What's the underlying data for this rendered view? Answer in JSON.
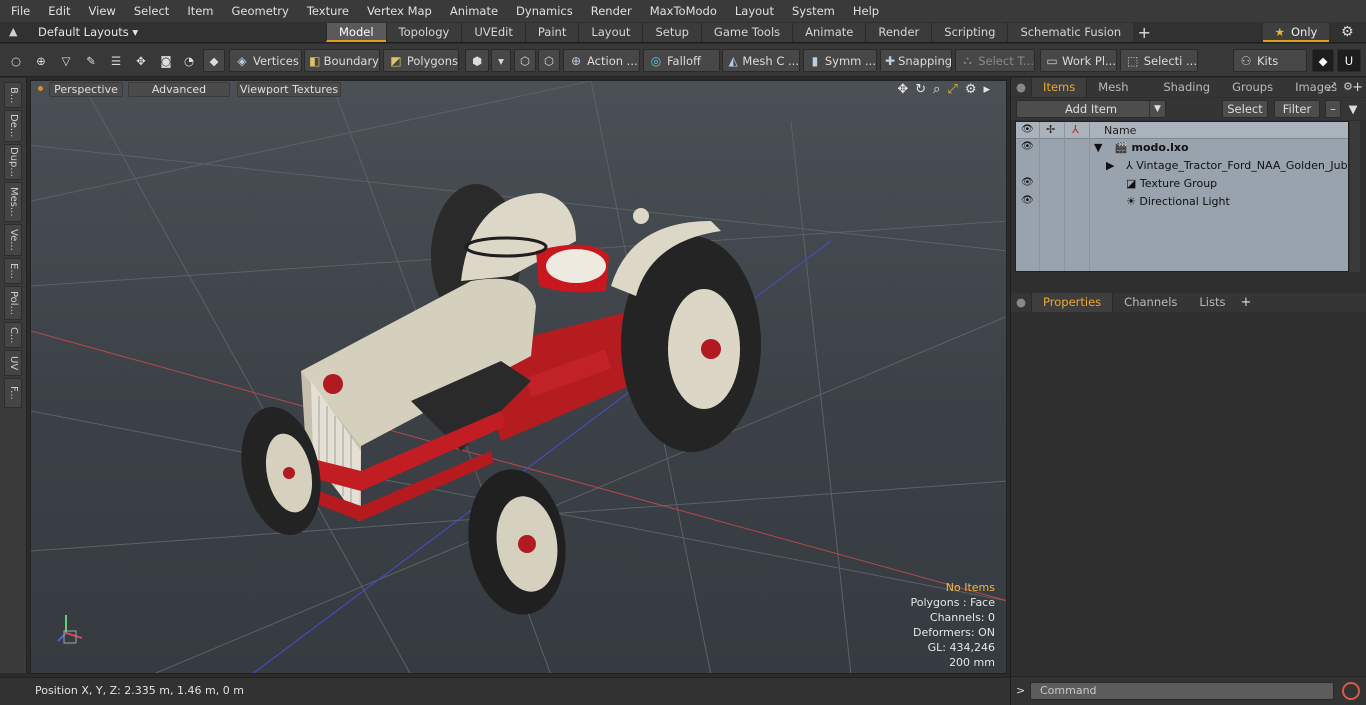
{
  "menu": [
    "File",
    "Edit",
    "View",
    "Select",
    "Item",
    "Geometry",
    "Texture",
    "Vertex Map",
    "Animate",
    "Dynamics",
    "Render",
    "MaxToModo",
    "Layout",
    "System",
    "Help"
  ],
  "layouts": {
    "label": "Default Layouts ▾"
  },
  "tabs": [
    "Model",
    "Topology",
    "UVEdit",
    "Paint",
    "Layout",
    "Setup",
    "Game Tools",
    "Animate",
    "Render",
    "Scripting",
    "Schematic Fusion"
  ],
  "active_tab": "Model",
  "only": {
    "label": "Only"
  },
  "toolbar": {
    "vertices": "Vertices",
    "boundary": "Boundary",
    "polygons": "Polygons",
    "action": "Action ...",
    "falloff": "Falloff",
    "mesh": "Mesh C ...",
    "symm": "Symm ...",
    "snapping": "Snapping",
    "select_t": "Select T...",
    "work_pl": "Work Pl...",
    "selecti": "Selecti ...",
    "kits": "Kits"
  },
  "left_strip": [
    "B...",
    "De...",
    "Dup...",
    "Mes...",
    "Ve...",
    "E...",
    "Pol...",
    "C...",
    "UV",
    "F..."
  ],
  "viewport": {
    "perspective": "Perspective",
    "advanced": "Advanced",
    "textures": "Viewport Textures",
    "stats": {
      "no_items": "No Items",
      "polygons": "Polygons : Face",
      "channels": "Channels: 0",
      "deformers": "Deformers: ON",
      "gl": "GL: 434,246",
      "scale": "200 mm"
    }
  },
  "status": {
    "position": "Position X, Y, Z:   2.335 m, 1.46 m, 0 m"
  },
  "right": {
    "tabs": [
      "Items",
      "Mesh ...",
      "Shading",
      "Groups",
      "Images"
    ],
    "active_tab": "Items",
    "add_item": "Add Item",
    "select": "Select",
    "filter": "Filter",
    "tree_header": "Name",
    "tree": [
      {
        "label": "modo.lxo",
        "bold": true
      },
      {
        "label": "Vintage_Tractor_Ford_NAA_Golden_Jub..."
      },
      {
        "label": "Texture Group"
      },
      {
        "label": "Directional Light"
      }
    ],
    "props_tabs": [
      "Properties",
      "Channels",
      "Lists"
    ],
    "props_active": "Properties",
    "command_placeholder": "Command"
  },
  "colors": {
    "accent": "#e4a01c",
    "tractor_red": "#c21d22",
    "tractor_cream": "#d9d3c3",
    "tire": "#262626"
  }
}
